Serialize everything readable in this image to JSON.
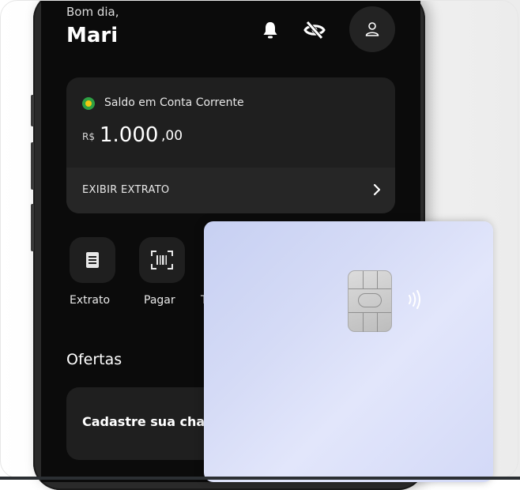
{
  "header": {
    "greeting": "Bom dia,",
    "user_name": "Mari",
    "icons": [
      "bell-icon",
      "eye-off-icon",
      "user-icon"
    ]
  },
  "balance": {
    "label": "Saldo em Conta Corrente",
    "currency": "R$",
    "amount_integer": "1.000",
    "amount_decimal": ",00",
    "statement_link": "EXIBIR EXTRATO"
  },
  "actions": [
    {
      "label": "Extrato",
      "icon": "receipt-icon"
    },
    {
      "label": "Pagar",
      "icon": "barcode-scan-icon"
    },
    {
      "label": "T",
      "icon": ""
    }
  ],
  "offers": {
    "title": "Ofertas",
    "promo_text": "Cadastre sua cha"
  },
  "colors": {
    "screen_bg": "#0b0b0b",
    "card_bg": "#1f1f1f",
    "credit_card": "#d5dbf6",
    "flag_green": "#2ea043",
    "flag_yellow": "#f2c811"
  }
}
